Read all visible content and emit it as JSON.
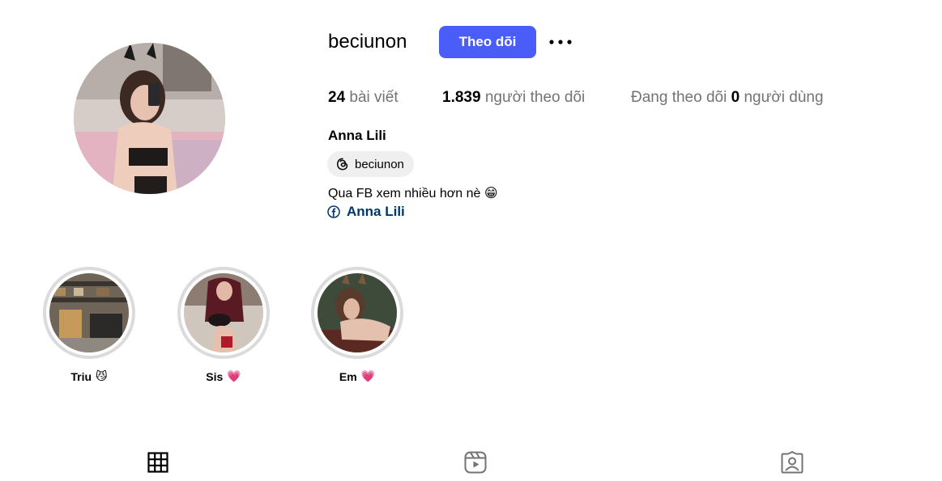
{
  "profile": {
    "username": "beciunon",
    "follow_label": "Theo dõi",
    "full_name": "Anna Lili",
    "threads_handle": "beciunon",
    "bio": "Qua FB xem nhiều hơn nè 😁",
    "fb_link": "Anna Lili"
  },
  "stats": {
    "posts_count": "24",
    "posts_label": "bài viết",
    "followers_count": "1.839",
    "followers_label": "người theo dõi",
    "following_prefix": "Đang theo dõi",
    "following_count": "0",
    "following_suffix": "người dùng"
  },
  "highlights": [
    {
      "title": "Triu",
      "emoji": "😼"
    },
    {
      "title": "Sis",
      "emoji": "💗"
    },
    {
      "title": "Em",
      "emoji": "💗"
    }
  ],
  "tabs": [
    {
      "icon": "grid-icon"
    },
    {
      "icon": "reels-icon"
    },
    {
      "icon": "tagged-icon"
    }
  ],
  "colors": {
    "accent": "#4a5df9",
    "link": "#00376b",
    "muted": "#737373"
  }
}
